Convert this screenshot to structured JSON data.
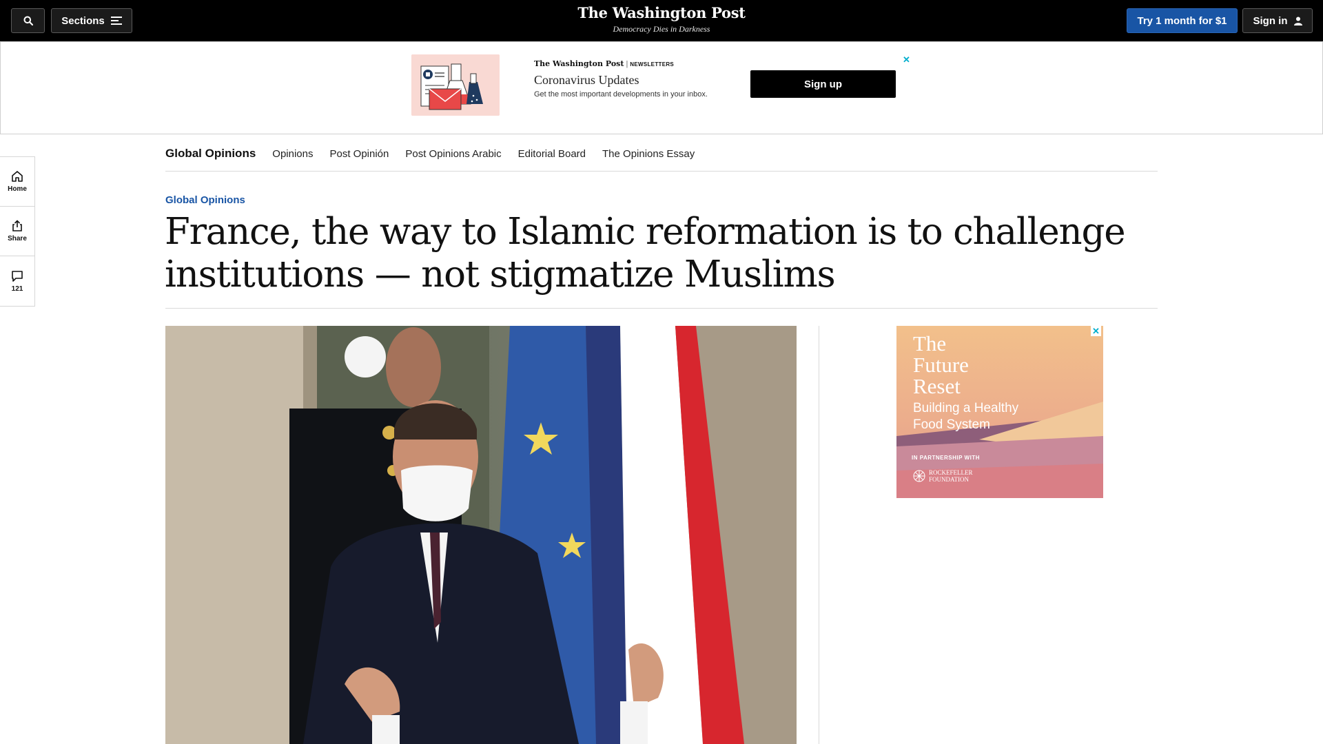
{
  "header": {
    "sections_label": "Sections",
    "logo": "The Washington Post",
    "tagline": "Democracy Dies in Darkness",
    "try_label": "Try 1 month for $1",
    "signin_label": "Sign in"
  },
  "newsletter_ad": {
    "brand": "The Washington Post",
    "brand_tag": "NEWSLETTERS",
    "title": "Coronavirus Updates",
    "description": "Get the most important developments in your inbox.",
    "signup_label": "Sign up",
    "close_glyph": "✕"
  },
  "share_rail": {
    "home_label": "Home",
    "share_label": "Share",
    "comment_count": "121"
  },
  "subnav": {
    "brand": "Global Opinions",
    "links": [
      "Opinions",
      "Post Opinión",
      "Post Opinions Arabic",
      "Editorial Board",
      "The Opinions Essay"
    ]
  },
  "article": {
    "kicker": "Global Opinions",
    "headline": "France, the way to Islamic reformation is to challenge institutions — not stigmatize Muslims"
  },
  "side_ad": {
    "title": "The Future Reset",
    "subtitle": "Building a Healthy Food System",
    "partner": "IN PARTNERSHIP WITH",
    "foundation_line1": "ROCKEFELLER",
    "foundation_line2": "FOUNDATION",
    "close_glyph": "✕"
  },
  "colors": {
    "accent_blue": "#1955a5",
    "ad_close": "#00aecd",
    "masthead_bg": "#000000"
  }
}
